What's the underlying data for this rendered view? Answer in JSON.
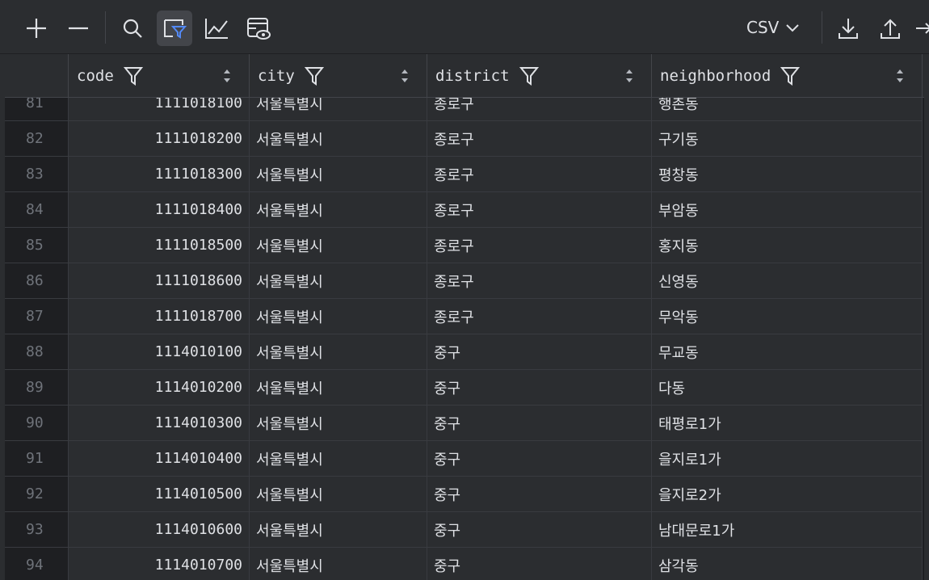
{
  "toolbar": {
    "icons": [
      "plus-icon",
      "minus-icon",
      "search-icon",
      "filter-icon",
      "chart-icon",
      "view-icon"
    ],
    "format_label": "CSV"
  },
  "columns": [
    {
      "name": "code"
    },
    {
      "name": "city"
    },
    {
      "name": "district"
    },
    {
      "name": "neighborhood"
    }
  ],
  "rows": [
    {
      "n": "81",
      "code": "1111018100",
      "city": "서울특별시",
      "district": "종로구",
      "neighborhood": "행촌동"
    },
    {
      "n": "82",
      "code": "1111018200",
      "city": "서울특별시",
      "district": "종로구",
      "neighborhood": "구기동"
    },
    {
      "n": "83",
      "code": "1111018300",
      "city": "서울특별시",
      "district": "종로구",
      "neighborhood": "평창동"
    },
    {
      "n": "84",
      "code": "1111018400",
      "city": "서울특별시",
      "district": "종로구",
      "neighborhood": "부암동"
    },
    {
      "n": "85",
      "code": "1111018500",
      "city": "서울특별시",
      "district": "종로구",
      "neighborhood": "홍지동"
    },
    {
      "n": "86",
      "code": "1111018600",
      "city": "서울특별시",
      "district": "종로구",
      "neighborhood": "신영동"
    },
    {
      "n": "87",
      "code": "1111018700",
      "city": "서울특별시",
      "district": "종로구",
      "neighborhood": "무악동"
    },
    {
      "n": "88",
      "code": "1114010100",
      "city": "서울특별시",
      "district": "중구",
      "neighborhood": "무교동"
    },
    {
      "n": "89",
      "code": "1114010200",
      "city": "서울특별시",
      "district": "중구",
      "neighborhood": "다동"
    },
    {
      "n": "90",
      "code": "1114010300",
      "city": "서울특별시",
      "district": "중구",
      "neighborhood": "태평로1가"
    },
    {
      "n": "91",
      "code": "1114010400",
      "city": "서울특별시",
      "district": "중구",
      "neighborhood": "을지로1가"
    },
    {
      "n": "92",
      "code": "1114010500",
      "city": "서울특별시",
      "district": "중구",
      "neighborhood": "을지로2가"
    },
    {
      "n": "93",
      "code": "1114010600",
      "city": "서울특별시",
      "district": "중구",
      "neighborhood": "남대문로1가"
    },
    {
      "n": "94",
      "code": "1114010700",
      "city": "서울특별시",
      "district": "중구",
      "neighborhood": "삼각동"
    }
  ]
}
